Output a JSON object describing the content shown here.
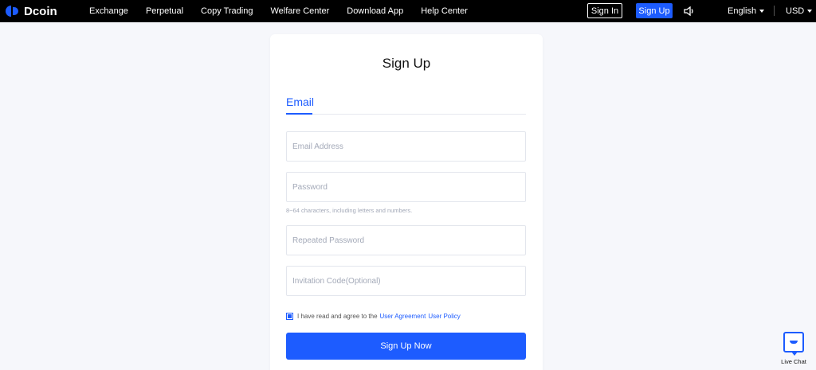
{
  "header": {
    "brand": "Dcoin",
    "nav": [
      "Exchange",
      "Perpetual",
      "Copy Trading",
      "Welfare Center",
      "Download App",
      "Help Center"
    ],
    "sign_in": "Sign In",
    "sign_up": "Sign Up",
    "language": "English",
    "currency": "USD"
  },
  "form": {
    "title": "Sign Up",
    "tab": "Email",
    "email_placeholder": "Email Address",
    "password_placeholder": "Password",
    "password_hint": "8~64 characters, including letters and numbers.",
    "repeat_placeholder": "Repeated Password",
    "invite_placeholder": "Invitation Code(Optional)",
    "agree_text": "I have read and agree to the",
    "agreement_link": "User Agreement",
    "policy_link": "User Policy",
    "submit": "Sign Up Now"
  },
  "live_chat": "Live Chat",
  "colors": {
    "accent": "#1d5cff",
    "topbar": "#000000",
    "background": "#f6f7fb"
  }
}
